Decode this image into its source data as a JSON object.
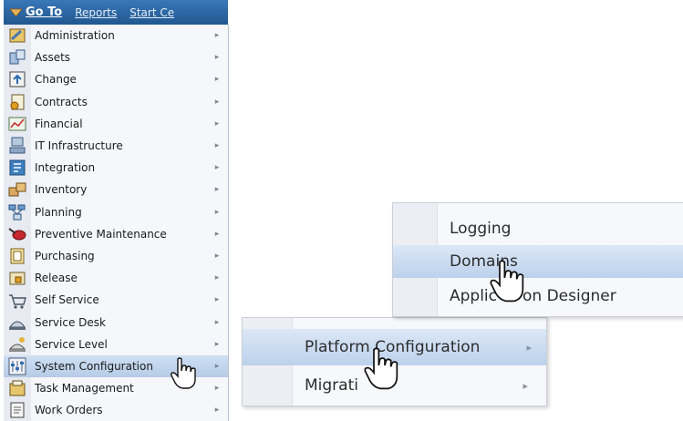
{
  "topbar": {
    "goto_label": "Go To",
    "links": [
      "Reports",
      "Start Ce"
    ]
  },
  "menu": {
    "items": [
      {
        "label": "Administration",
        "icon": "administration-icon"
      },
      {
        "label": "Assets",
        "icon": "assets-icon"
      },
      {
        "label": "Change",
        "icon": "change-icon"
      },
      {
        "label": "Contracts",
        "icon": "contracts-icon"
      },
      {
        "label": "Financial",
        "icon": "financial-icon"
      },
      {
        "label": "IT Infrastructure",
        "icon": "it-infrastructure-icon"
      },
      {
        "label": "Integration",
        "icon": "integration-icon"
      },
      {
        "label": "Inventory",
        "icon": "inventory-icon"
      },
      {
        "label": "Planning",
        "icon": "planning-icon"
      },
      {
        "label": "Preventive Maintenance",
        "icon": "preventive-maintenance-icon"
      },
      {
        "label": "Purchasing",
        "icon": "purchasing-icon"
      },
      {
        "label": "Release",
        "icon": "release-icon"
      },
      {
        "label": "Self Service",
        "icon": "self-service-icon"
      },
      {
        "label": "Service Desk",
        "icon": "service-desk-icon"
      },
      {
        "label": "Service Level",
        "icon": "service-level-icon"
      },
      {
        "label": "System Configuration",
        "icon": "system-configuration-icon",
        "selected": true
      },
      {
        "label": "Task Management",
        "icon": "task-management-icon"
      },
      {
        "label": "Work Orders",
        "icon": "work-orders-icon"
      }
    ]
  },
  "submenu_system_configuration": {
    "items": [
      {
        "label": "Platform Configuration",
        "selected": true
      },
      {
        "label": "Migrati"
      }
    ]
  },
  "submenu_platform_configuration": {
    "items": [
      {
        "label": "Logging"
      },
      {
        "label": "Domains",
        "selected": true
      },
      {
        "label": "Applic"
      },
      {
        "label": "on Designer"
      }
    ]
  },
  "colors": {
    "topbar": "#2d6aa6",
    "selected_row": "#bcd1ec",
    "menu_bg": "#f6f7fa"
  }
}
